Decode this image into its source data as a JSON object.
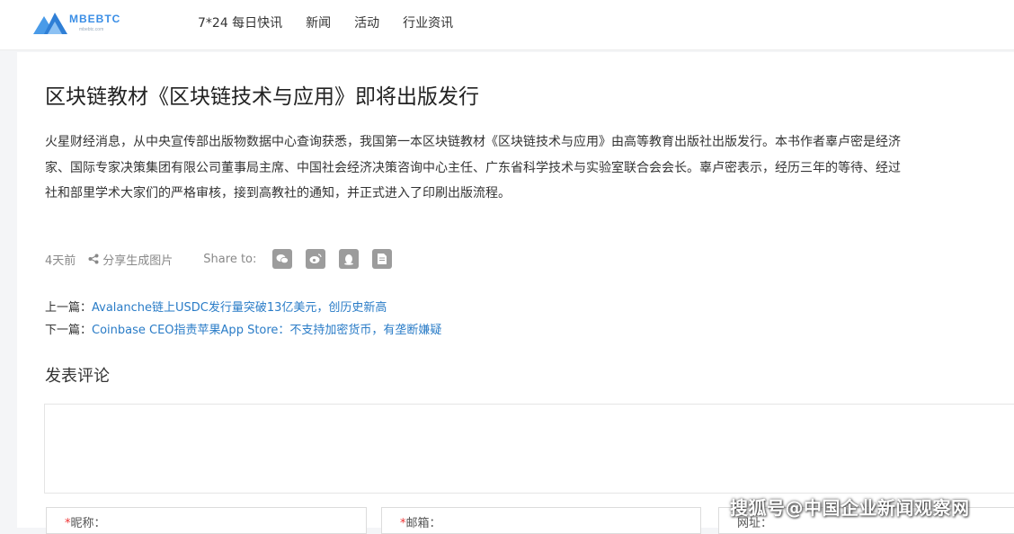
{
  "header": {
    "logo_text": "MBEBTC",
    "logo_subtext": "mbebtc.com",
    "nav": [
      "7*24 每日快讯",
      "新闻",
      "活动",
      "行业资讯"
    ]
  },
  "article": {
    "title": "区块链教材《区块链技术与应用》即将出版发行",
    "paragraph_lines": [
      "火星财经消息，从中央宣传部出版物数据中心查询获悉，我国第一本区块链教材《区块链技术与应用》由高等教育出版社出版发行。本书作者辜卢密是经济",
      "家、国际专家决策集团有限公司董事局主席、中国社会经济决策咨询中心主任、广东省科学技术与实验室联合会会长。辜卢密表示，经历三年的等待、经过",
      "社和部里学术大家们的严格审核，接到高教社的通知，并正式进入了印刷出版流程。"
    ],
    "time": "4天前",
    "share_generate": "分享生成图片",
    "share_to": "Share to:",
    "share_icons": [
      "wechat-icon",
      "weibo-icon",
      "qq-icon",
      "document-icon"
    ],
    "icon_color": "#9c9c9c"
  },
  "navigation": {
    "prev_label": "上一篇：",
    "prev_title": "Avalanche链上USDC发行量突破13亿美元，创历史新高",
    "next_label": "下一篇：",
    "next_title": "Coinbase CEO指责苹果App Store：不支持加密货币，有垄断嫌疑",
    "link_color": "#2a7cc7"
  },
  "comment": {
    "title": "发表评论",
    "fields": [
      {
        "required": true,
        "label": "昵称："
      },
      {
        "required": true,
        "label": "邮箱："
      },
      {
        "required": false,
        "label": "网址："
      }
    ]
  },
  "watermark": "搜狐号@中国企业新闻观察网"
}
